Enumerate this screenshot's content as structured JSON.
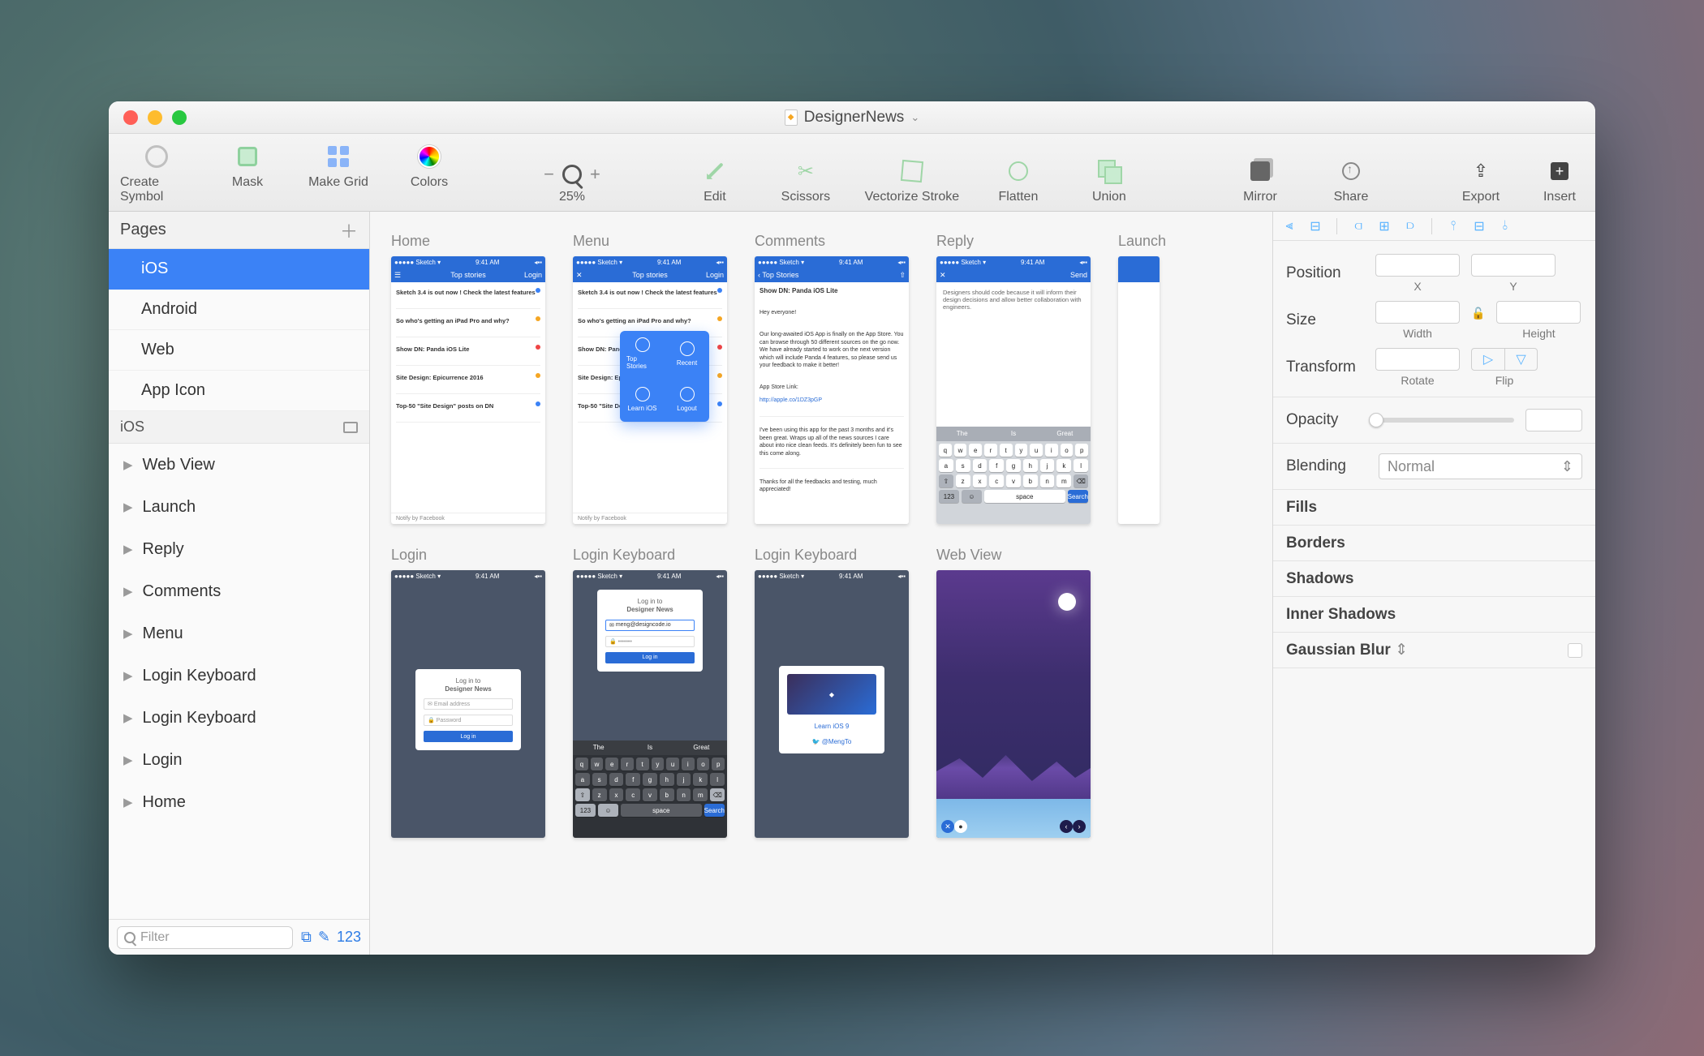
{
  "title": "DesignerNews",
  "toolbar": {
    "left": [
      {
        "label": "Create Symbol"
      },
      {
        "label": "Mask"
      },
      {
        "label": "Make Grid"
      },
      {
        "label": "Colors"
      }
    ],
    "zoom": "25%",
    "mid": [
      {
        "label": "Edit"
      },
      {
        "label": "Scissors"
      },
      {
        "label": "Vectorize Stroke"
      },
      {
        "label": "Flatten"
      },
      {
        "label": "Union"
      }
    ],
    "right": [
      {
        "label": "Mirror"
      },
      {
        "label": "Share"
      }
    ],
    "far": [
      {
        "label": "Export"
      },
      {
        "label": "Insert"
      }
    ]
  },
  "left": {
    "pages_label": "Pages",
    "pages": [
      {
        "name": "iOS",
        "selected": true
      },
      {
        "name": "Android"
      },
      {
        "name": "Web"
      },
      {
        "name": "App Icon"
      }
    ],
    "section": "iOS",
    "artboards": [
      "Web View",
      "Launch",
      "Reply",
      "Comments",
      "Menu",
      "Login Keyboard",
      "Login Keyboard",
      "Login",
      "Home"
    ],
    "filter_placeholder": "Filter",
    "count": "123"
  },
  "canvas": {
    "row1": [
      "Home",
      "Menu",
      "Comments",
      "Reply",
      "Launch"
    ],
    "row2": [
      "Login",
      "Login Keyboard",
      "Login Keyboard",
      "Web View"
    ]
  },
  "screens": {
    "statusbar_time": "9:41 AM",
    "home": {
      "nav_center": "Top stories",
      "nav_right": "Login",
      "items": [
        {
          "t": "Sketch 3.4 is out now ! Check the latest features",
          "m": "",
          "dot": "blue"
        },
        {
          "t": "So who's getting an iPad Pro and why?",
          "m": "",
          "dot": "orange"
        },
        {
          "t": "Show DN: Panda iOS Lite",
          "m": "",
          "dot": "red"
        },
        {
          "t": "Site Design: Epicurrence 2016",
          "m": "",
          "dot": "orange"
        },
        {
          "t": "Top-50 \"Site Design\" posts on DN",
          "m": "",
          "dot": "blue"
        }
      ],
      "footer": "Notify by Facebook"
    },
    "menu": {
      "pop": [
        "Top Stories",
        "Recent",
        "Learn iOS",
        "Logout"
      ]
    },
    "comments": {
      "nav_left": "Top Stories",
      "title": "Show DN: Panda iOS Lite",
      "greet": "Hey everyone!",
      "para": "Our long-awaited iOS App is finally on the App Store. You can browse through 50 different sources on the go now. We have already started to work on the next version which will include Panda 4 features, so please send us your feedback to make it better!",
      "link_label": "App Store Link:",
      "link": "http://apple.co/1DZ3pGP",
      "reply": "I've been using this app for the past 3 months and it's been great. Wraps up all of the news sources I care about into nice clean feeds. It's definitely been fun to see this come along.",
      "thanks": "Thanks for all the feedbacks and testing, much appreciated!"
    },
    "reply": {
      "nav_left": "✕",
      "nav_right": "Send",
      "text": "Designers should code because it will inform their design decisions and allow better collaboration with engineers.",
      "sugg": [
        "The",
        "Is",
        "Great"
      ],
      "kb_send": "Search"
    },
    "login": {
      "title_small": "Log in to",
      "title_big": "Designer News",
      "in1": "Email address",
      "in2": "Password",
      "btn": "Log in"
    },
    "loginkb": {
      "email": "meng@designcode.io",
      "sugg": [
        "The",
        "Is",
        "Great"
      ]
    },
    "loginkb2": {
      "learn": "Learn iOS 9",
      "handle": "@MengTo"
    }
  },
  "inspector": {
    "position": {
      "label": "Position",
      "x": "X",
      "y": "Y"
    },
    "size": {
      "label": "Size",
      "w": "Width",
      "h": "Height"
    },
    "transform": {
      "label": "Transform",
      "r": "Rotate",
      "f": "Flip"
    },
    "opacity": "Opacity",
    "blending": {
      "label": "Blending",
      "value": "Normal"
    },
    "sections": [
      "Fills",
      "Borders",
      "Shadows",
      "Inner Shadows",
      "Gaussian Blur"
    ]
  }
}
